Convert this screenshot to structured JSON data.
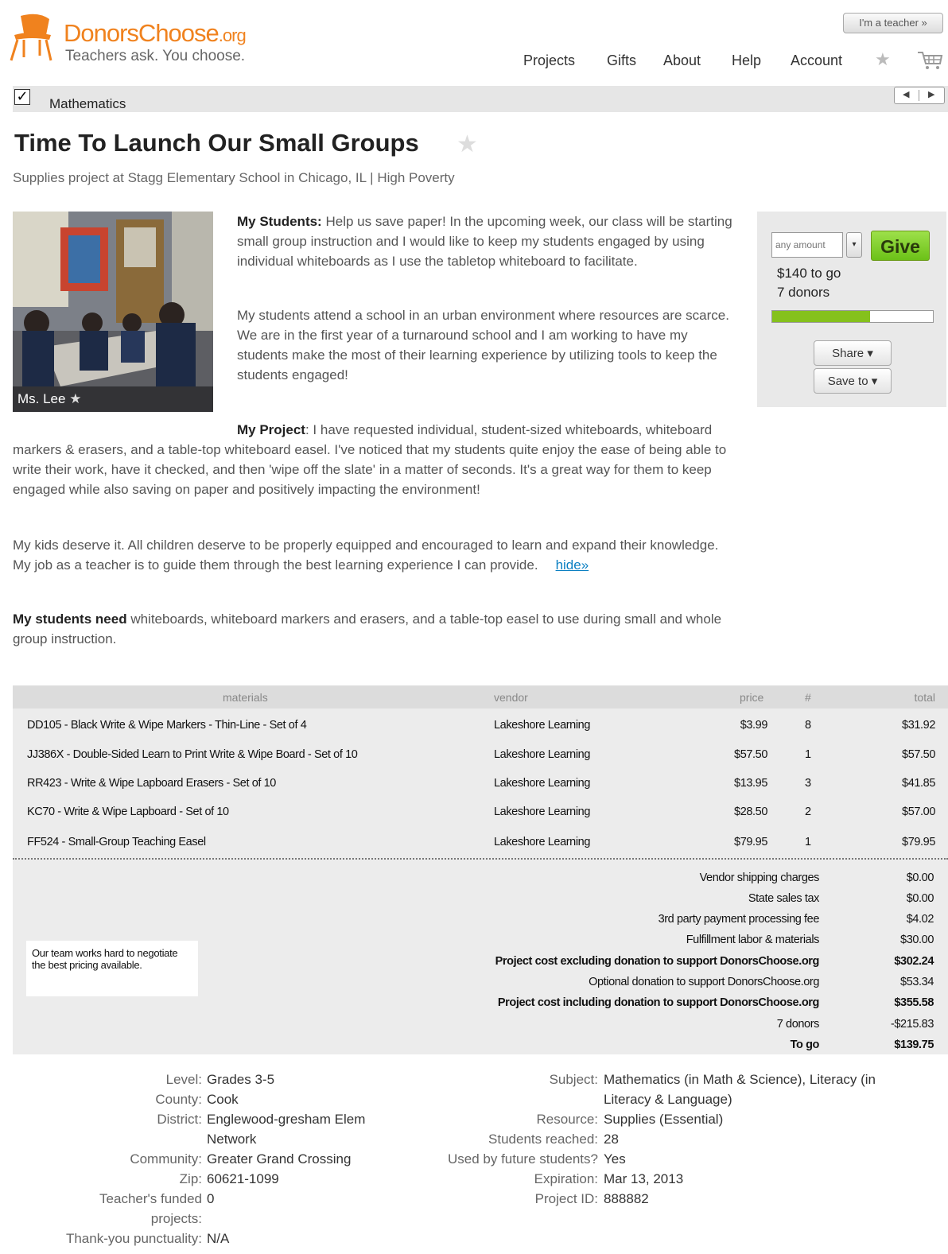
{
  "header": {
    "logo_name": "DonorsChoose",
    "logo_org": ".org",
    "tagline": "Teachers ask. You choose.",
    "teacher_button": "I'm a teacher »",
    "nav": [
      "Projects",
      "Gifts",
      "About",
      "Help",
      "Account"
    ],
    "brand_color": "#f0821e"
  },
  "subject_bar": {
    "checked": true,
    "label": "Mathematics"
  },
  "project": {
    "title": "Time To Launch Our Small Groups",
    "subtitle": "Supplies project at Stagg Elementary School in Chicago, IL  |  High Poverty",
    "teacher": "Ms. Lee",
    "students_label": "My Students:",
    "students_text": "Help us save paper! In the upcoming week, our class will be starting small group instruction and I would like to keep my students engaged by using individual whiteboards as I use the tabletop whiteboard to facilitate.",
    "school_text": "My students attend a school in an urban environment where resources are scarce. We are in the first year of a turnaround school and I am working to have my students make the most of their learning experience by utilizing tools to keep the students engaged!",
    "project_label": "My Project",
    "project_text": ": I have requested individual, student-sized whiteboards, whiteboard markers & erasers, and a table-top whiteboard easel. I've noticed that my students quite enjoy the ease of being able to write their work, have it checked, and then 'wipe off the slate' in a matter of seconds. It's a great way for them to keep engaged while also saving on paper and positively impacting the environment!",
    "kids_text": "My kids deserve it. All children deserve to be properly equipped and encouraged to learn and expand their knowledge. My job as a teacher is to guide them through the best learning experience I can provide.",
    "hide_link": "hide»",
    "need_label": "My students need",
    "need_text": " whiteboards, whiteboard markers and erasers, and a table-top easel to use during small and whole group instruction."
  },
  "donate": {
    "amount_placeholder": "any amount",
    "give_label": "Give",
    "to_go": "$140 to go",
    "donors": "7 donors",
    "progress_fraction": 0.61,
    "share_label": "Share ▾",
    "save_label": "Save to ▾",
    "accent_color": "#85c11c"
  },
  "materials": {
    "headers": [
      "materials",
      "vendor",
      "price",
      "#",
      "total"
    ],
    "rows": [
      [
        "DD105 - Black Write & Wipe Markers - Thin-Line - Set of 4",
        "Lakeshore Learning",
        "$3.99",
        "8",
        "$31.92"
      ],
      [
        "JJ386X - Double-Sided Learn to Print Write & Wipe Board - Set of 10",
        "Lakeshore Learning",
        "$57.50",
        "1",
        "$57.50"
      ],
      [
        "RR423 - Write & Wipe Lapboard Erasers - Set of 10",
        "Lakeshore Learning",
        "$13.95",
        "3",
        "$41.85"
      ],
      [
        "KC70 - Write & Wipe Lapboard - Set of 10",
        "Lakeshore Learning",
        "$28.50",
        "2",
        "$57.00"
      ],
      [
        "FF524 - Small-Group Teaching Easel",
        "Lakeshore Learning",
        "$79.95",
        "1",
        "$79.95"
      ]
    ],
    "summary": [
      [
        "Vendor shipping charges",
        "$0.00"
      ],
      [
        "State sales tax",
        "$0.00"
      ],
      [
        "3rd party payment processing fee",
        "$4.02"
      ],
      [
        "Fulfillment labor & materials",
        "$30.00"
      ],
      [
        "Project cost excluding donation to support DonorsChoose.org",
        "$302.24"
      ],
      [
        "Optional donation to support DonorsChoose.org",
        "$53.34"
      ],
      [
        "Project cost including donation to support DonorsChoose.org",
        "$355.58"
      ],
      [
        "7 donors",
        "-$215.83"
      ],
      [
        "To go",
        "$139.75"
      ]
    ],
    "note": "Our team works hard to negotiate the best pricing available."
  },
  "details": {
    "left": [
      [
        "Level:",
        "Grades 3-5"
      ],
      [
        "County:",
        "Cook"
      ],
      [
        "District:",
        "Englewood-gresham Elem"
      ],
      [
        "",
        "Network"
      ],
      [
        "Community:",
        "Greater Grand Crossing"
      ],
      [
        "Zip:",
        "60621-1099"
      ],
      [
        "Teacher's funded",
        "0"
      ],
      [
        "projects:",
        ""
      ],
      [
        "Thank-you punctuality:",
        "N/A"
      ]
    ],
    "right": [
      [
        "Subject:",
        "Mathematics (in Math & Science), Literacy (in"
      ],
      [
        "",
        "Literacy & Language)"
      ],
      [
        "Resource:",
        "Supplies (Essential)"
      ],
      [
        "Students reached:",
        "28"
      ],
      [
        "Used by future students?",
        "Yes"
      ],
      [
        "Expiration:",
        "Mar 13, 2013"
      ],
      [
        "Project ID:",
        "888882"
      ]
    ]
  }
}
